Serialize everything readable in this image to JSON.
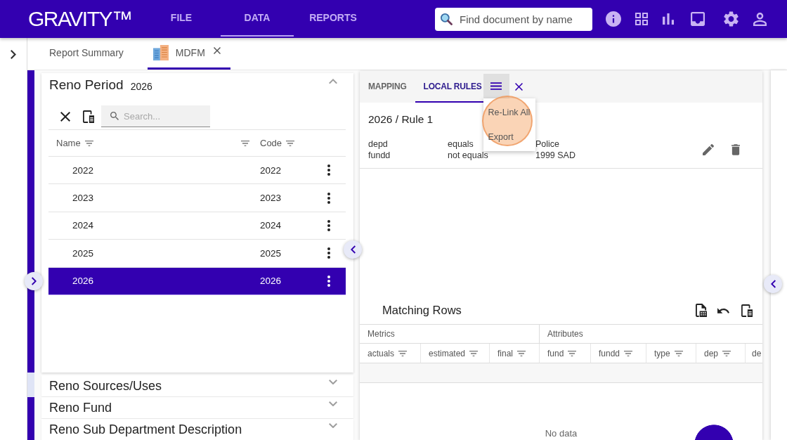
{
  "app_bar": {
    "logo": "GRAVITY™",
    "nav": [
      {
        "label": "FILE",
        "selected": false
      },
      {
        "label": "DATA",
        "selected": true
      },
      {
        "label": "REPORTS",
        "selected": false
      }
    ],
    "search": {
      "placeholder": "Find document by name"
    }
  },
  "doc_tabs": [
    {
      "label": "Report Summary",
      "selected": false,
      "icon": false,
      "closable": false
    },
    {
      "label": "MDFM",
      "selected": true,
      "icon": true,
      "closable": true
    }
  ],
  "period_panel": {
    "title": "Reno Period",
    "value": "2026",
    "expanded": true,
    "search": {
      "placeholder": "Search..."
    },
    "columns": [
      {
        "label": "Name",
        "menu_icon": true
      },
      {
        "label": "Code",
        "menu_icon": false
      }
    ],
    "rows": [
      {
        "name": "2022",
        "code": "2022",
        "selected": false
      },
      {
        "name": "2023",
        "code": "2023",
        "selected": false
      },
      {
        "name": "2024",
        "code": "2024",
        "selected": false
      },
      {
        "name": "2025",
        "code": "2025",
        "selected": false
      },
      {
        "name": "2026",
        "code": "2026",
        "selected": true
      }
    ]
  },
  "accordion": [
    {
      "title": "Reno Sources/Uses",
      "expanded": false
    },
    {
      "title": "Reno Fund",
      "expanded": false
    },
    {
      "title": "Reno Sub Department Description",
      "expanded": false
    }
  ],
  "rules_panel": {
    "tabs": [
      {
        "label": "MAPPING",
        "selected": false
      },
      {
        "label": "LOCAL RULES",
        "selected": true
      }
    ],
    "menu": {
      "open": true,
      "items": [
        {
          "label": "Re-Link All",
          "highlighted": true
        },
        {
          "label": "Export",
          "highlighted": false
        }
      ]
    },
    "rule": {
      "title": "2026 / Rule 1",
      "conditions": [
        {
          "field": "depd",
          "operator": "equals",
          "value": "Police"
        },
        {
          "field": "fundd",
          "operator": "not equals",
          "value": "1999 SAD"
        }
      ]
    }
  },
  "matching_rows": {
    "title": "Matching Rows",
    "column_groups": [
      {
        "label": "Metrics",
        "columns": [
          {
            "label": "actuals",
            "filter": true
          },
          {
            "label": "estimated",
            "filter": true
          },
          {
            "label": "final",
            "filter": true
          }
        ]
      },
      {
        "label": "Attributes",
        "columns": [
          {
            "label": "fund",
            "filter": true
          },
          {
            "label": "fundd",
            "filter": true
          },
          {
            "label": "type",
            "filter": true
          },
          {
            "label": "dep",
            "filter": true
          },
          {
            "label": "de"
          }
        ]
      }
    ],
    "empty_message": "No data"
  }
}
